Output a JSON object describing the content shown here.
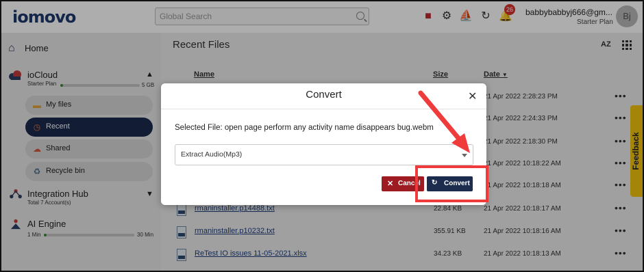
{
  "header": {
    "logo": "iomovo",
    "search_placeholder": "Global Search",
    "notification_count": "26",
    "user_email": "babbybabbyj666@gm...",
    "user_plan": "Starter Plan",
    "avatar_initials": "Bj"
  },
  "sidebar": {
    "home": "Home",
    "iocloud": {
      "title": "ioCloud",
      "plan": "Starter Plan",
      "storage_total": "5 GB",
      "items": [
        {
          "label": "My files",
          "icon": "folder-icon"
        },
        {
          "label": "Recent",
          "icon": "clock-icon"
        },
        {
          "label": "Shared",
          "icon": "shared-icon"
        },
        {
          "label": "Recycle bin",
          "icon": "recycle-icon"
        }
      ]
    },
    "integration_hub": {
      "title": "Integration Hub",
      "sub": "Total 7 Account(s)"
    },
    "ai_engine": {
      "title": "AI Engine",
      "min_start": "1 Min",
      "min_end": "30 Min"
    }
  },
  "main": {
    "title": "Recent Files",
    "sort_label": "AZ",
    "columns": {
      "name": "Name",
      "size": "Size",
      "date": "Date"
    },
    "rows": [
      {
        "name": "",
        "size": "",
        "date": "21 Apr 2022 2:28:23 PM"
      },
      {
        "name": "",
        "size": "",
        "date": "21 Apr 2022 2:24:33 PM"
      },
      {
        "name": "",
        "size": "",
        "date": "21 Apr 2022 2:18:30 PM"
      },
      {
        "name": "",
        "size": "",
        "date": "21 Apr 2022 10:18:22 AM"
      },
      {
        "name": "",
        "size": "",
        "date": "21 Apr 2022 10:18:18 AM"
      },
      {
        "name": "rmaninstaller.p14488.txt",
        "size": "22.84 KB",
        "date": "21 Apr 2022 10:18:17 AM"
      },
      {
        "name": "rmaninstaller.p10232.txt",
        "size": "355.91 KB",
        "date": "21 Apr 2022 10:18:16 AM"
      },
      {
        "name": "ReTest IO issues 11-05-2021.xlsx",
        "size": "34.23 KB",
        "date": "21 Apr 2022 10:18:13 AM"
      }
    ],
    "more_icon": "•••"
  },
  "feedback": "Feedback",
  "modal": {
    "title": "Convert",
    "selected_file": "Selected File: open page perform any activity name disappears bug.webm",
    "select_value": "Extract Audio(Mp3)",
    "cancel_label": "Cancel",
    "convert_label": "Convert"
  },
  "colors": {
    "brand_navy": "#1b2c4f",
    "cancel_red": "#9f1b22",
    "annotation_red": "#ef3b3b",
    "feedback_yellow": "#f4c30f"
  }
}
